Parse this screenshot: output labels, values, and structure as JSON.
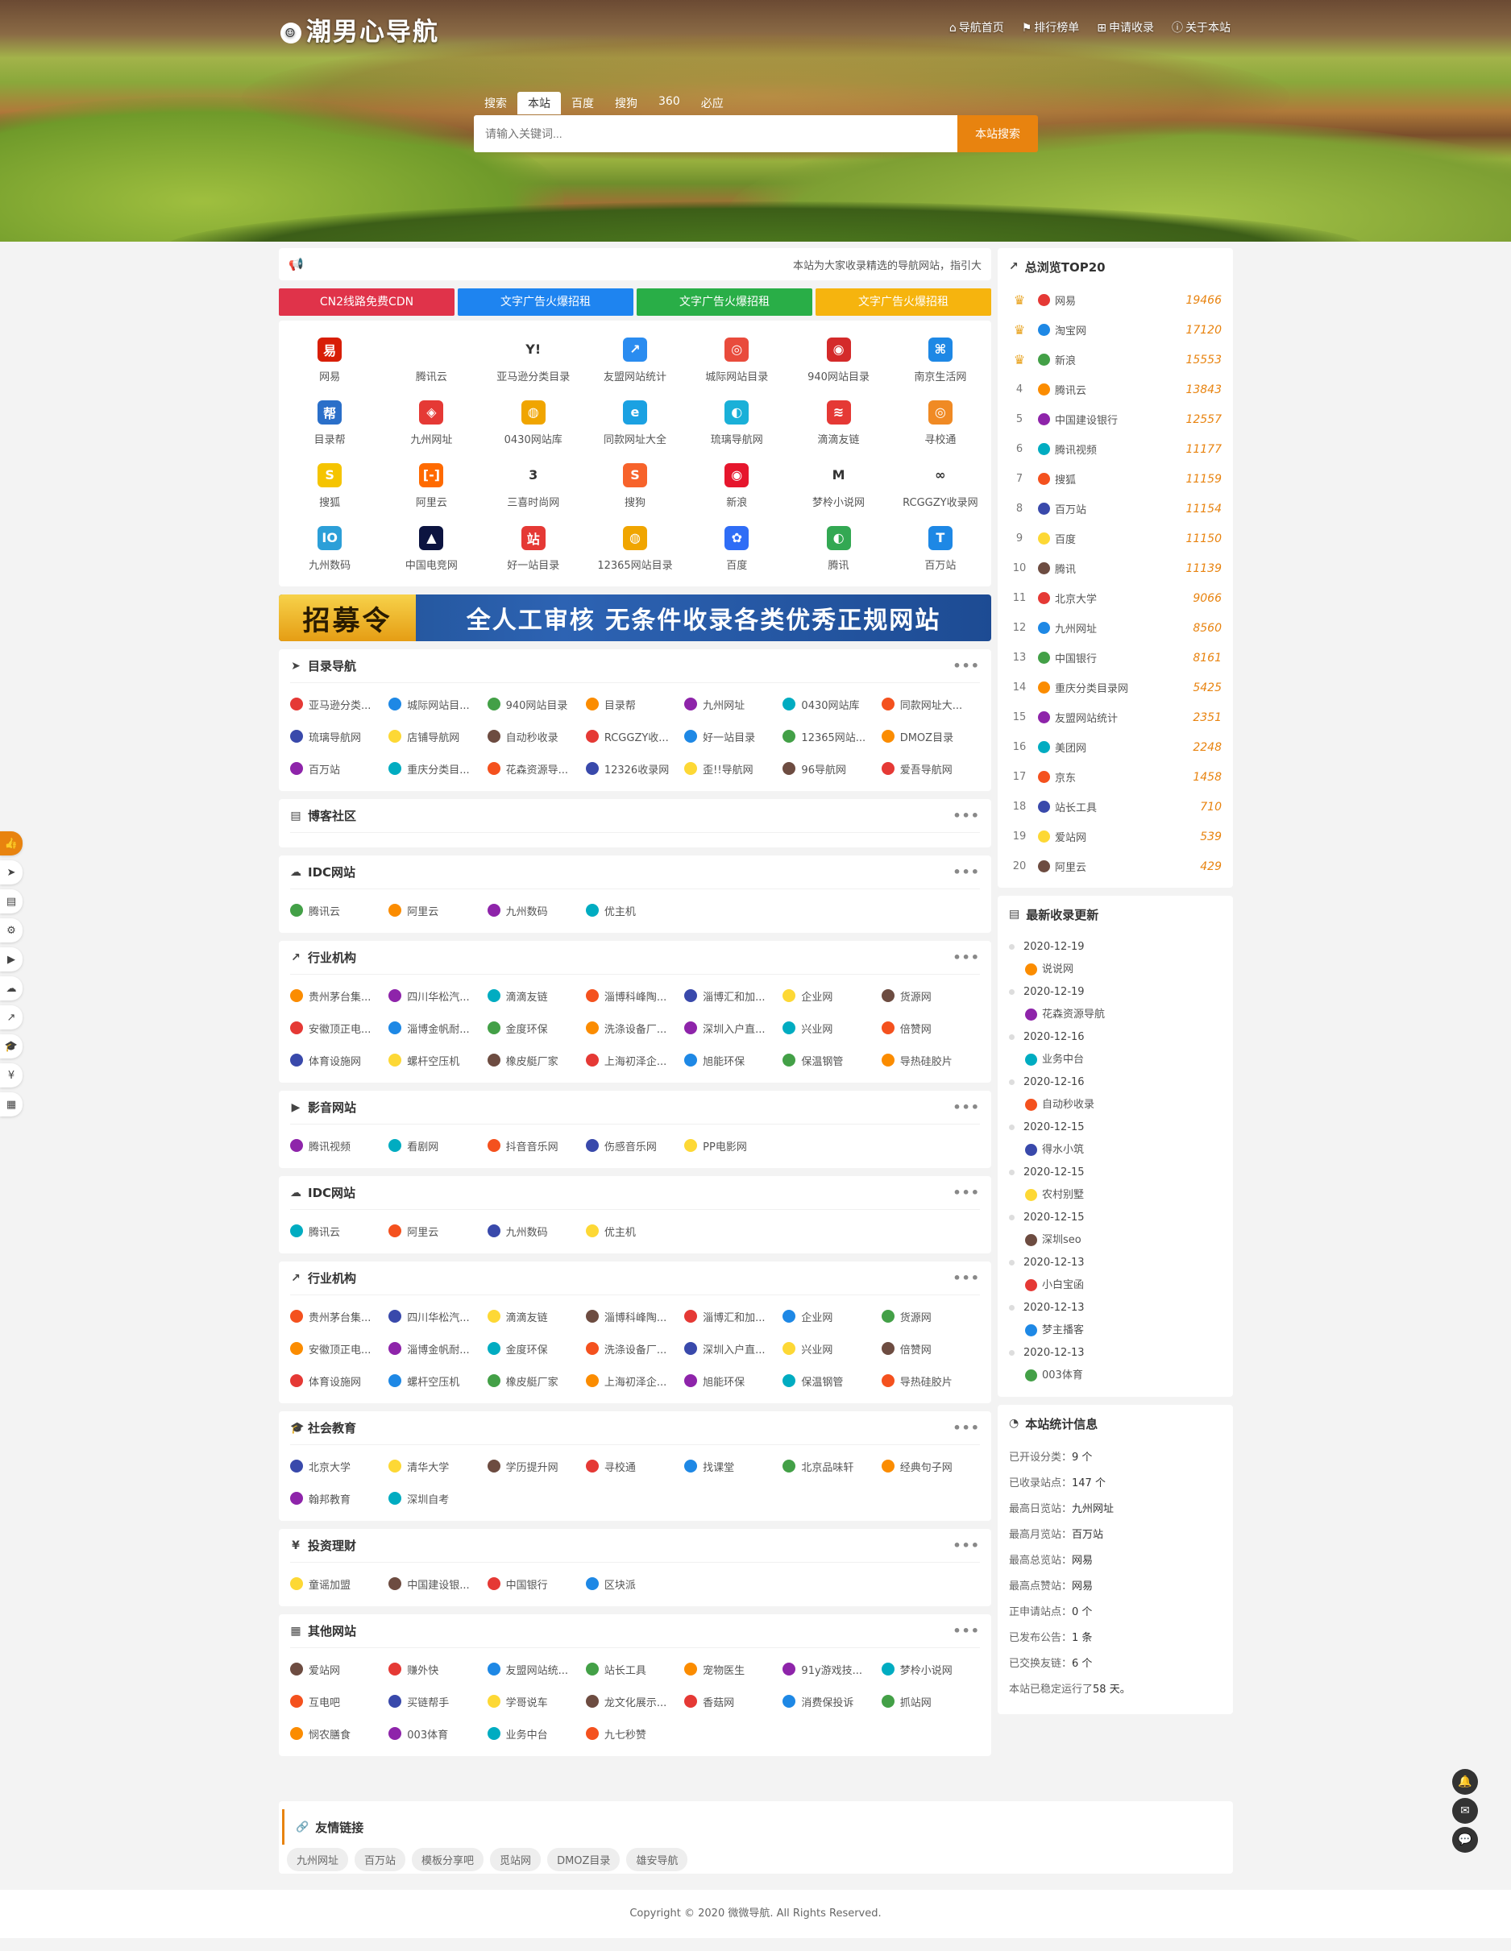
{
  "header": {
    "logo": "潮男心导航",
    "nav": [
      "导航首页",
      "排行榜单",
      "申请收录",
      "关于本站"
    ],
    "nav_icons": [
      "home-icon",
      "flag-icon",
      "plus-square-icon",
      "info-icon"
    ]
  },
  "search": {
    "tabs": [
      "搜索",
      "本站",
      "百度",
      "搜狗",
      "360",
      "必应"
    ],
    "active_tab": "本站",
    "placeholder": "请输入关键词...",
    "button": "本站搜索"
  },
  "notice": {
    "text": "本站为大家收录精选的导航网站，指引大"
  },
  "ads": [
    {
      "label": "CN2线路免费CDN",
      "color": "#e0334a"
    },
    {
      "label": "文字广告火爆招租",
      "color": "#1e84f0"
    },
    {
      "label": "文字广告火爆招租",
      "color": "#29ae47"
    },
    {
      "label": "文字广告火爆招租",
      "color": "#f6b40e"
    }
  ],
  "featured": [
    {
      "label": "网易",
      "color": "#d81e06",
      "glyph": "易"
    },
    {
      "label": "腾讯云",
      "color": "#ffffff",
      "glyph": ""
    },
    {
      "label": "亚马逊分类目录",
      "color": "#ffffff",
      "glyph": "Y!"
    },
    {
      "label": "友盟网站统计",
      "color": "#2a8cf0",
      "glyph": "↗"
    },
    {
      "label": "城际网站目录",
      "color": "#e94b3c",
      "glyph": "◎"
    },
    {
      "label": "940网站目录",
      "color": "#d42a2a",
      "glyph": "◉"
    },
    {
      "label": "南京生活网",
      "color": "#1e88e5",
      "glyph": "⌘"
    },
    {
      "label": "目录帮",
      "color": "#2a6fc9",
      "glyph": "帮"
    },
    {
      "label": "九州网址",
      "color": "#e53935",
      "glyph": "◈"
    },
    {
      "label": "0430网站库",
      "color": "#f0a500",
      "glyph": "◍"
    },
    {
      "label": "同款网址大全",
      "color": "#1ba1e2",
      "glyph": "e"
    },
    {
      "label": "琉璃导航网",
      "color": "#1ab0d8",
      "glyph": "◐"
    },
    {
      "label": "滴滴友链",
      "color": "#e53935",
      "glyph": "≋"
    },
    {
      "label": "寻校通",
      "color": "#f08a24",
      "glyph": "◎"
    },
    {
      "label": "搜狐",
      "color": "#f5c400",
      "glyph": "S"
    },
    {
      "label": "阿里云",
      "color": "#ff6a00",
      "glyph": "[-]"
    },
    {
      "label": "三喜时尚网",
      "color": "#ffffff",
      "glyph": "3"
    },
    {
      "label": "搜狗",
      "color": "#f7632b",
      "glyph": "S"
    },
    {
      "label": "新浪",
      "color": "#e6162d",
      "glyph": "◉"
    },
    {
      "label": "梦柃小说网",
      "color": "#ffffff",
      "glyph": "M"
    },
    {
      "label": "RCGGZY收录网",
      "color": "#ffffff",
      "glyph": "∞"
    },
    {
      "label": "九州数码",
      "color": "#2c9fd8",
      "glyph": "IO"
    },
    {
      "label": "中国电竞网",
      "color": "#0c1440",
      "glyph": "▲"
    },
    {
      "label": "好一站目录",
      "color": "#e53935",
      "glyph": "站"
    },
    {
      "label": "12365网站目录",
      "color": "#f0a500",
      "glyph": "◍"
    },
    {
      "label": "百度",
      "color": "#2f6df6",
      "glyph": "✿"
    },
    {
      "label": "腾讯",
      "color": "#33a853",
      "glyph": "◐"
    },
    {
      "label": "百万站",
      "color": "#1e88e5",
      "glyph": "T"
    }
  ],
  "banner": {
    "tag": "招募令",
    "text": "全人工审核  无条件收录各类优秀正规网站"
  },
  "sections": [
    {
      "title": "目录导航",
      "icon": "paper-plane-icon",
      "items": [
        "亚马逊分类...",
        "城际网站目...",
        "940网站目录",
        "目录帮",
        "九州网址",
        "0430网站库",
        "同款网址大...",
        "琉璃导航网",
        "店铺导航网",
        "自动秒收录",
        "RCGGZY收...",
        "好一站目录",
        "12365网站...",
        "DMOZ目录",
        "百万站",
        "重庆分类目...",
        "花森资源导...",
        "12326收录网",
        "歪!!导航网",
        "96导航网",
        "爱吾导航网"
      ]
    },
    {
      "title": "博客社区",
      "icon": "file-icon",
      "items": []
    },
    {
      "title": "IDC网站",
      "icon": "cloud-icon",
      "items": [
        "腾讯云",
        "阿里云",
        "九州数码",
        "优主机"
      ]
    },
    {
      "title": "行业机构",
      "icon": "chart-line-icon",
      "items": [
        "贵州茅台集...",
        "四川华松汽...",
        "滴滴友链",
        "淄博科峰陶...",
        "淄博汇和加...",
        "企业网",
        "货源网",
        "安徽顶正电...",
        "淄博金帆耐...",
        "金度环保",
        "洗涤设备厂...",
        "深圳入户直...",
        "兴业网",
        "倍赞网",
        "体育设施网",
        "螺杆空压机",
        "橡皮艇厂家",
        "上海初泽企...",
        "旭能环保",
        "保温钢管",
        "导热硅胶片"
      ]
    },
    {
      "title": "影音网站",
      "icon": "video-icon",
      "items": [
        "腾讯视频",
        "看剧网",
        "抖音音乐网",
        "伤感音乐网",
        "PP电影网"
      ]
    },
    {
      "title": "IDC网站",
      "icon": "cloud-icon",
      "items": [
        "腾讯云",
        "阿里云",
        "九州数码",
        "优主机"
      ]
    },
    {
      "title": "行业机构",
      "icon": "chart-line-icon",
      "items": [
        "贵州茅台集...",
        "四川华松汽...",
        "滴滴友链",
        "淄博科峰陶...",
        "淄博汇和加...",
        "企业网",
        "货源网",
        "安徽顶正电...",
        "淄博金帆耐...",
        "金度环保",
        "洗涤设备厂...",
        "深圳入户直...",
        "兴业网",
        "倍赞网",
        "体育设施网",
        "螺杆空压机",
        "橡皮艇厂家",
        "上海初泽企...",
        "旭能环保",
        "保温钢管",
        "导热硅胶片"
      ]
    },
    {
      "title": "社会教育",
      "icon": "graduation-cap-icon",
      "items": [
        "北京大学",
        "清华大学",
        "学历提升网",
        "寻校通",
        "找课堂",
        "北京品味轩",
        "经典句子网",
        "翰邦教育",
        "深圳自考"
      ]
    },
    {
      "title": "投资理财",
      "icon": "yen-icon",
      "items": [
        "童谣加盟",
        "中国建设银...",
        "中国银行",
        "区块派"
      ]
    },
    {
      "title": "其他网站",
      "icon": "grid-icon",
      "items": [
        "爱站网",
        "赚外快",
        "友盟网站统...",
        "站长工具",
        "宠物医生",
        "91y游戏技...",
        "梦柃小说网",
        "互电吧",
        "买链帮手",
        "学哥说车",
        "龙文化展示...",
        "香菇网",
        "消费保投诉",
        "抓站网",
        "悯农膳食",
        "003体育",
        "业务中台",
        "九七秒赞"
      ]
    }
  ],
  "rank": {
    "title": "总浏览TOP20",
    "items": [
      {
        "n": "1",
        "name": "网易",
        "v": "19466"
      },
      {
        "n": "2",
        "name": "淘宝网",
        "v": "17120"
      },
      {
        "n": "3",
        "name": "新浪",
        "v": "15553"
      },
      {
        "n": "4",
        "name": "腾讯云",
        "v": "13843"
      },
      {
        "n": "5",
        "name": "中国建设银行",
        "v": "12557"
      },
      {
        "n": "6",
        "name": "腾讯视频",
        "v": "11177"
      },
      {
        "n": "7",
        "name": "搜狐",
        "v": "11159"
      },
      {
        "n": "8",
        "name": "百万站",
        "v": "11154"
      },
      {
        "n": "9",
        "name": "百度",
        "v": "11150"
      },
      {
        "n": "10",
        "name": "腾讯",
        "v": "11139"
      },
      {
        "n": "11",
        "name": "北京大学",
        "v": "9066"
      },
      {
        "n": "12",
        "name": "九州网址",
        "v": "8560"
      },
      {
        "n": "13",
        "name": "中国银行",
        "v": "8161"
      },
      {
        "n": "14",
        "name": "重庆分类目录网",
        "v": "5425"
      },
      {
        "n": "15",
        "name": "友盟网站统计",
        "v": "2351"
      },
      {
        "n": "16",
        "name": "美团网",
        "v": "2248"
      },
      {
        "n": "17",
        "name": "京东",
        "v": "1458"
      },
      {
        "n": "18",
        "name": "站长工具",
        "v": "710"
      },
      {
        "n": "19",
        "name": "爱站网",
        "v": "539"
      },
      {
        "n": "20",
        "name": "阿里云",
        "v": "429"
      }
    ]
  },
  "latest": {
    "title": "最新收录更新",
    "items": [
      {
        "date": "2020-12-19",
        "name": "说说网"
      },
      {
        "date": "2020-12-19",
        "name": "花森资源导航"
      },
      {
        "date": "2020-12-16",
        "name": "业务中台"
      },
      {
        "date": "2020-12-16",
        "name": "自动秒收录"
      },
      {
        "date": "2020-12-15",
        "name": "得水小筑"
      },
      {
        "date": "2020-12-15",
        "name": "农村别墅"
      },
      {
        "date": "2020-12-15",
        "name": "深圳seo"
      },
      {
        "date": "2020-12-13",
        "name": "小白宝函"
      },
      {
        "date": "2020-12-13",
        "name": "梦主播客"
      },
      {
        "date": "2020-12-13",
        "name": "003体育"
      }
    ]
  },
  "stats": {
    "title": "本站统计信息",
    "items": [
      {
        "k": "已开设分类：",
        "v": "9 个"
      },
      {
        "k": "已收录站点：",
        "v": "147 个"
      },
      {
        "k": "最高日览站：",
        "v": "九州网址"
      },
      {
        "k": "最高月览站：",
        "v": "百万站"
      },
      {
        "k": "最高总览站：",
        "v": "网易"
      },
      {
        "k": "最高点赞站：",
        "v": "网易"
      },
      {
        "k": "正申请站点：",
        "v": "0 个"
      },
      {
        "k": "已发布公告：",
        "v": "1 条"
      },
      {
        "k": "已交换友链：",
        "v": "6 个"
      },
      {
        "k": "本站已稳定运行了",
        "v": "58 天。"
      }
    ]
  },
  "friends": {
    "title": "友情链接",
    "items": [
      "九州网址",
      "百万站",
      "模板分享吧",
      "觅站网",
      "DMOZ目录",
      "雄安导航"
    ]
  },
  "footer": "Copyright © 2020 微微导航. All Rights Reserved.",
  "colors": {
    "accent": "#e8830f",
    "rank_value": "#e8830f"
  }
}
